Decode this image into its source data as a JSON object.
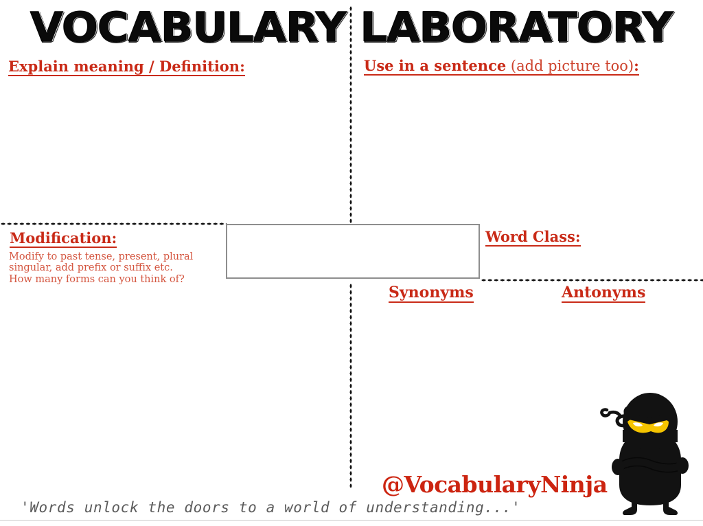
{
  "title": "VOCABULARY LABORATORY",
  "sections": {
    "definition": {
      "heading": "Explain meaning / Definition:"
    },
    "sentence": {
      "heading_bold": "Use in a sentence",
      "heading_light": " (add picture too)",
      "heading_tail": ":"
    },
    "modification": {
      "heading": "Modification:",
      "line1": "Modify to past tense, present, plural",
      "line2": "singular, add prefix or suffix etc.",
      "line3": "How many forms can you think of?"
    },
    "word_class": {
      "heading": "Word Class:"
    },
    "synonyms": {
      "heading": "Synonyms"
    },
    "antonyms": {
      "heading": "Antonyms"
    },
    "word_box": {
      "value": ""
    }
  },
  "footer": {
    "brand": "@VocabularyNinja",
    "quote": "'Words unlock the doors to a world of understanding...'"
  },
  "icons": {
    "mascot": "ninja-mascot-icon"
  },
  "colors": {
    "heading_red": "#c92a17",
    "brand_red": "#cc2410",
    "sub_red": "#d4553f",
    "box_border_grey": "#8e8e8e",
    "quote_grey": "#5b5b5b",
    "dot_black": "#111111",
    "ninja_body": "#121212",
    "ninja_eyes": "#f5c400"
  }
}
